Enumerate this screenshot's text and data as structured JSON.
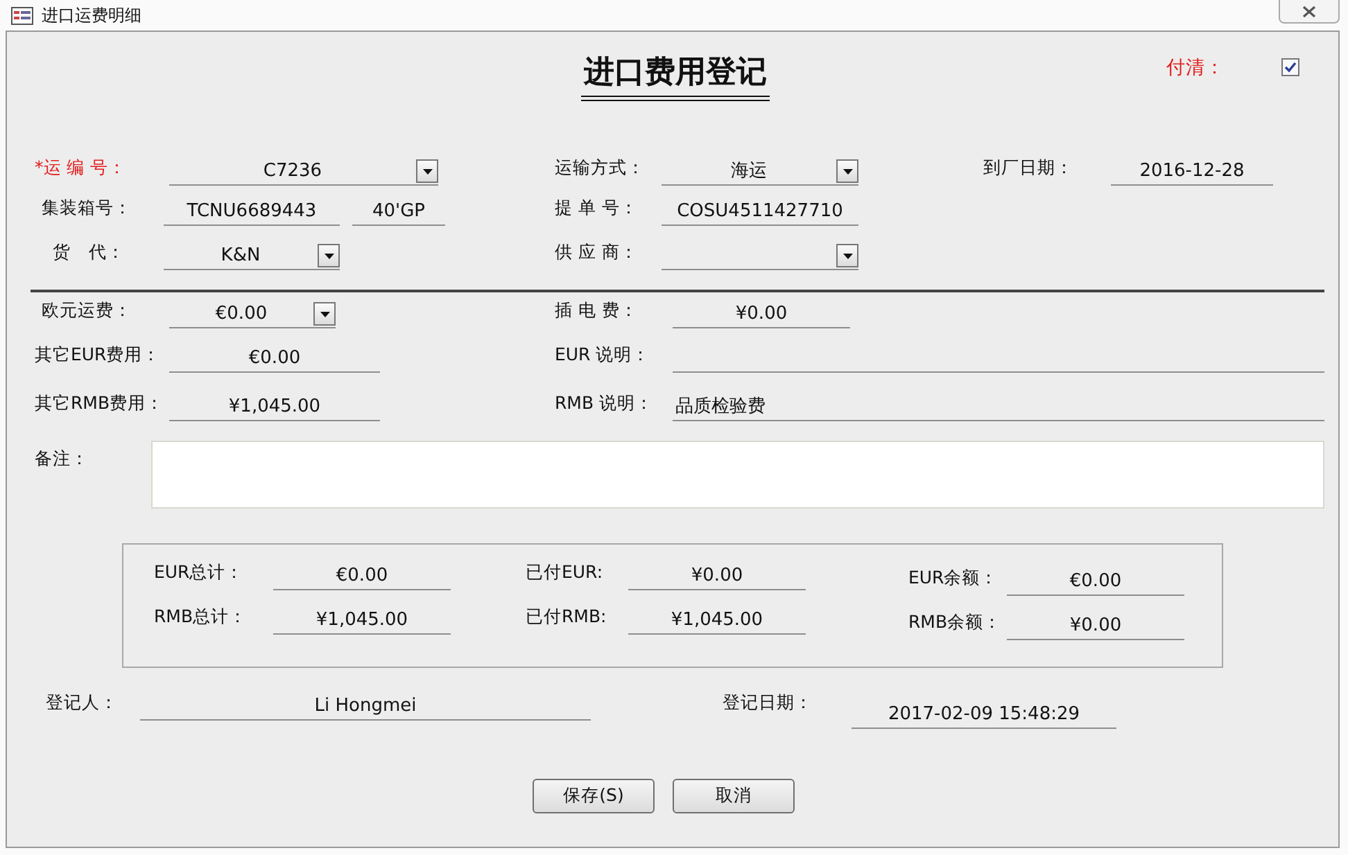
{
  "window": {
    "title": "进口运费明细"
  },
  "form": {
    "title": "进口费用登记",
    "paid": {
      "label": "付清：",
      "checked": true
    }
  },
  "fields": [
    {
      "label": "*运 编 号：",
      "kind": "combo",
      "value": "C7236",
      "required": true
    },
    {
      "label": "运输方式：",
      "kind": "combo",
      "value": "海运"
    },
    {
      "label": "到厂日期：",
      "kind": "text",
      "value": "2016-12-28"
    },
    {
      "label": "集装箱号：",
      "kind": "text",
      "value": "TCNU6689443"
    },
    {
      "kind": "text",
      "value": "40'GP"
    },
    {
      "label": "提 单 号：",
      "kind": "text",
      "value": "COSU4511427710"
    },
    {
      "label": "货　代：",
      "kind": "combo",
      "value": "K&N"
    },
    {
      "label": "供 应 商：",
      "kind": "combo"
    },
    {
      "label": "欧元运费：",
      "kind": "combo",
      "value": "€0.00"
    },
    {
      "label": "插 电 费：",
      "kind": "text",
      "value": "¥0.00"
    },
    {
      "label": "其它EUR费用：",
      "kind": "text",
      "value": "€0.00"
    },
    {
      "label": "EUR 说明：",
      "kind": "text"
    },
    {
      "label": "其它RMB费用：",
      "kind": "text",
      "value": "¥1,045.00"
    },
    {
      "label": "RMB 说明：",
      "kind": "text",
      "value": "品质检验费"
    },
    {
      "label": "备注：",
      "kind": "memo"
    }
  ],
  "totals": [
    {
      "label": "EUR总计：",
      "value": "€0.00"
    },
    {
      "label": "已付EUR:",
      "value": "¥0.00"
    },
    {
      "label": "EUR余额：",
      "value": "€0.00"
    },
    {
      "label": "RMB总计：",
      "value": "¥1,045.00"
    },
    {
      "label": "已付RMB:",
      "value": "¥1,045.00"
    },
    {
      "label": "RMB余额：",
      "value": "¥0.00"
    }
  ],
  "footer": [
    {
      "label": "登记人：",
      "value": "Li Hongmei"
    },
    {
      "label": "登记日期：",
      "value": "2017-02-09 15:48:29"
    }
  ],
  "buttons": [
    "保存(S)",
    "取消"
  ]
}
